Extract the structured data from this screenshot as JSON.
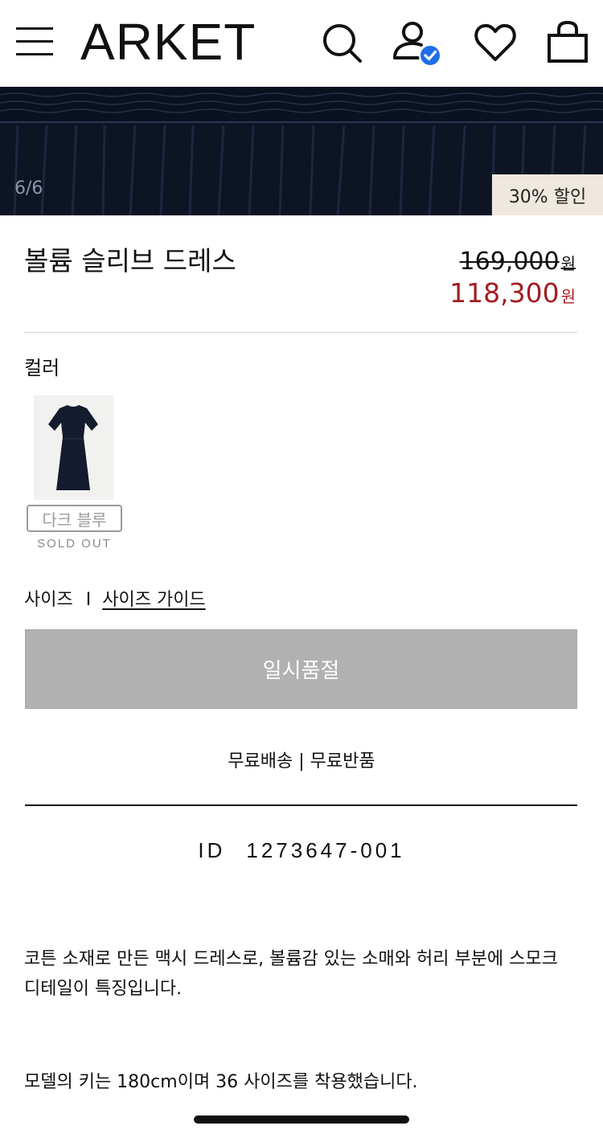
{
  "header": {
    "logo": "ARKET",
    "icons": [
      "menu-icon",
      "search-icon",
      "account-verified-icon",
      "heart-icon",
      "shopping-bag-icon"
    ]
  },
  "gallery": {
    "counter": "6/6",
    "discount_badge": "30% 할인"
  },
  "product": {
    "title": "볼륨 슬리브 드레스",
    "original_price": "169,000",
    "sale_price": "118,300",
    "currency": "원",
    "color_label": "컬러",
    "color_name": "다크 블루",
    "color_status": "SOLD OUT",
    "size_label": "사이즈",
    "size_separator": "I",
    "size_guide": "사이즈 가이드",
    "cta_label": "일시품절",
    "shipping_info": "무료배송 | 무료반품",
    "id_label": "ID",
    "id_value": "1273647-001",
    "description": "코튼 소재로 만든 맥시 드레스로, 볼륨감 있는 소매와 허리 부분에 스모크 디테일이 특징입니다.",
    "model_info": "모델의 키는 180cm이며 36 사이즈를 착용했습니다."
  },
  "colors": {
    "sale_red": "#a31e24",
    "dress_navy": "#141b2e",
    "badge_bg": "#efe8de",
    "button_gray": "#b1b1b1"
  }
}
